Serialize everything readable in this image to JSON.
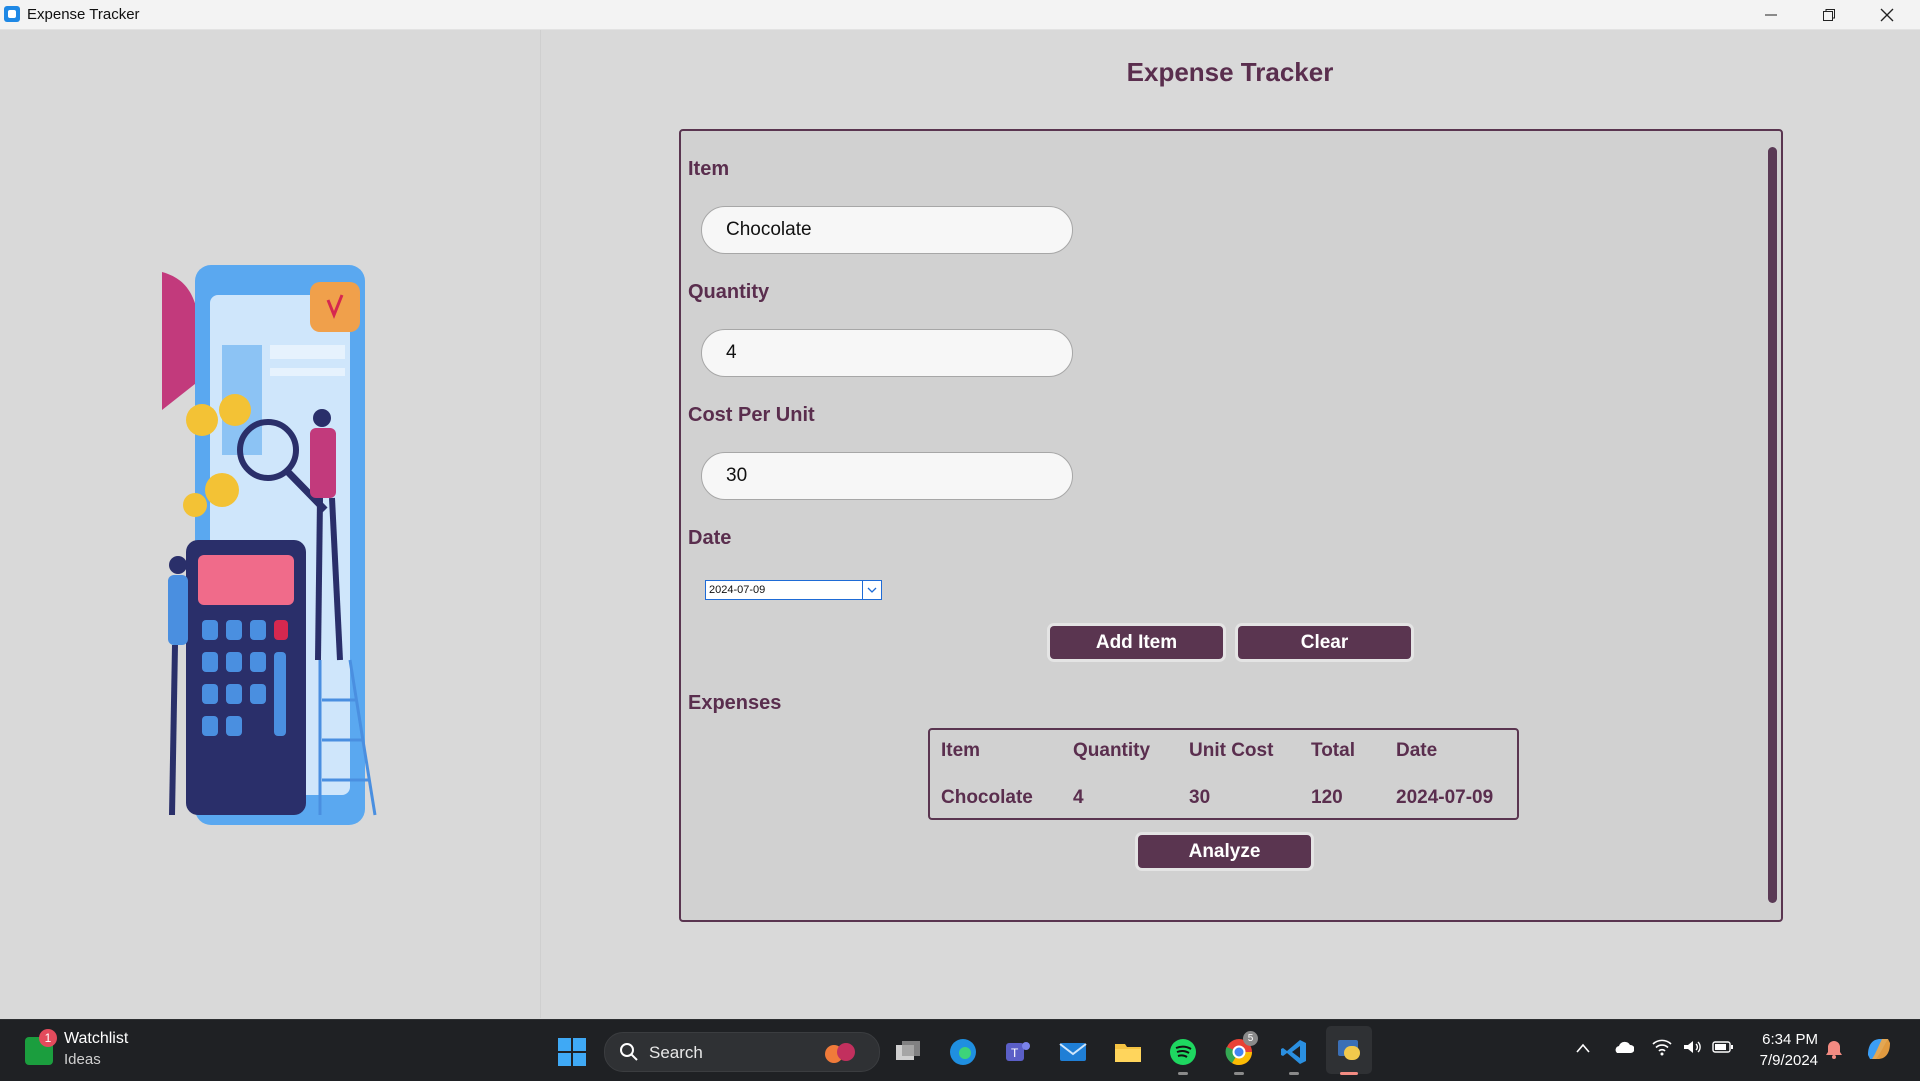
{
  "window": {
    "title": "Expense Tracker"
  },
  "app": {
    "title": "Expense Tracker",
    "form": {
      "item_label": "Item",
      "item_value": "Chocolate",
      "quantity_label": "Quantity",
      "quantity_value": "4",
      "cost_label": "Cost Per Unit",
      "cost_value": "30",
      "date_label": "Date",
      "date_value": "2024-07-09"
    },
    "buttons": {
      "add": "Add Item",
      "clear": "Clear",
      "analyze": "Analyze"
    },
    "expenses": {
      "label": "Expenses",
      "columns": [
        "Item",
        "Quantity",
        "Unit Cost",
        "Total",
        "Date"
      ],
      "rows": [
        [
          "Chocolate",
          "4",
          "30",
          "120",
          "2024-07-09"
        ]
      ]
    },
    "colors": {
      "accent": "#5a3550",
      "title": "#5a2e4e",
      "background": "#d9d9d9"
    }
  },
  "taskbar": {
    "widget_title": "Watchlist",
    "widget_subtitle": "Ideas",
    "widget_badge": "1",
    "search_placeholder": "Search",
    "time": "6:34 PM",
    "date": "7/9/2024",
    "chrome_badge": "5",
    "apps": [
      "start-icon",
      "task-view-icon",
      "edge-icon",
      "teams-icon",
      "mail-icon",
      "file-explorer-icon",
      "spotify-icon",
      "chrome-icon",
      "vscode-icon",
      "python-app-icon"
    ]
  }
}
